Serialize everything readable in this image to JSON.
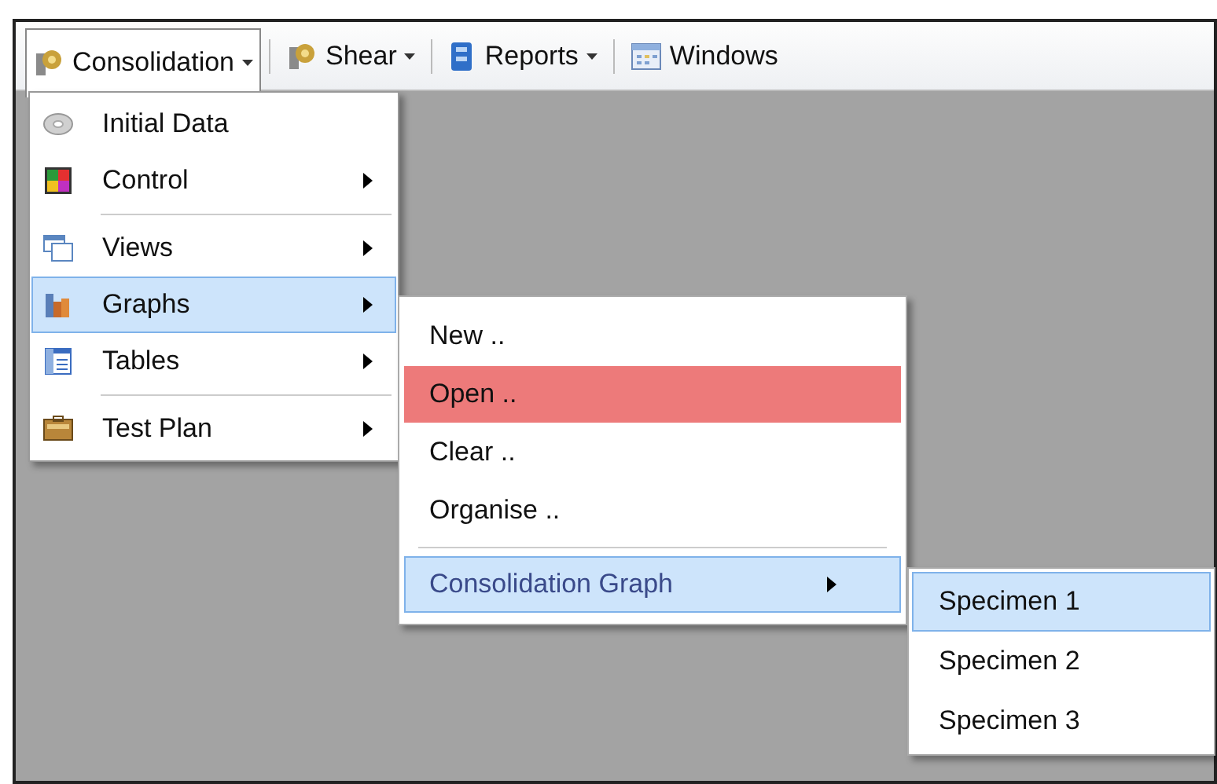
{
  "toolbar": [
    {
      "label": "Consolidation",
      "dropdown": true,
      "open": true
    },
    {
      "label": "Shear",
      "dropdown": true,
      "open": false
    },
    {
      "label": "Reports",
      "dropdown": true,
      "open": false
    },
    {
      "label": "Windows",
      "dropdown": false,
      "open": false
    }
  ],
  "menu": [
    {
      "kind": "item",
      "label": "Initial Data",
      "submenu": false,
      "selected": false
    },
    {
      "kind": "item",
      "label": "Control",
      "submenu": true,
      "selected": false
    },
    {
      "kind": "separator"
    },
    {
      "kind": "item",
      "label": "Views",
      "submenu": true,
      "selected": false
    },
    {
      "kind": "item",
      "label": "Graphs",
      "submenu": true,
      "selected": true
    },
    {
      "kind": "item",
      "label": "Tables",
      "submenu": true,
      "selected": false
    },
    {
      "kind": "separator"
    },
    {
      "kind": "item",
      "label": "Test Plan",
      "submenu": true,
      "selected": false
    }
  ],
  "graphs_menu": [
    {
      "kind": "item",
      "label": "New ..",
      "submenu": false,
      "selected": false,
      "highlighted": false
    },
    {
      "kind": "item",
      "label": "Open ..",
      "submenu": false,
      "selected": false,
      "highlighted": true
    },
    {
      "kind": "item",
      "label": "Clear ..",
      "submenu": false,
      "selected": false,
      "highlighted": false
    },
    {
      "kind": "item",
      "label": "Organise ..",
      "submenu": false,
      "selected": false,
      "highlighted": false
    },
    {
      "kind": "separator"
    },
    {
      "kind": "item",
      "label": "Consolidation Graph",
      "submenu": true,
      "selected": true,
      "highlighted": false
    }
  ],
  "graph_menu": [
    {
      "label": "Specimen 1",
      "selected": true
    },
    {
      "label": "Specimen 2",
      "selected": false
    },
    {
      "label": "Specimen 3",
      "selected": false
    }
  ]
}
